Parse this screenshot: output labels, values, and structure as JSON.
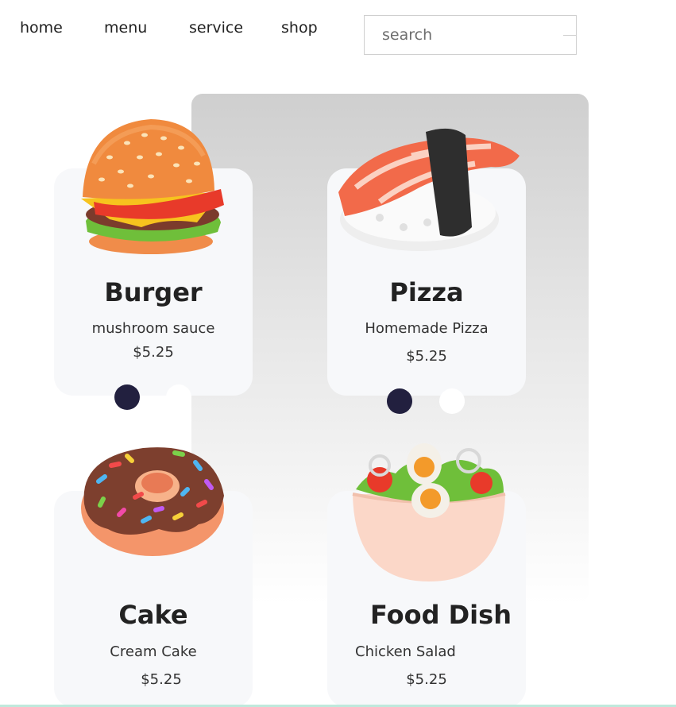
{
  "nav": {
    "items": [
      "home",
      "menu",
      "service",
      "shop"
    ]
  },
  "search": {
    "placeholder": "search"
  },
  "cards": [
    {
      "title": "Burger",
      "desc": "mushroom sauce",
      "price": "$5.25",
      "icon": "burger-icon"
    },
    {
      "title": "Pizza",
      "desc": "Homemade Pizza",
      "price": "$5.25",
      "icon": "sushi-icon"
    },
    {
      "title": "Cake",
      "desc": "Cream Cake",
      "price": "$5.25",
      "icon": "donut-icon"
    },
    {
      "title": "Food Dish",
      "desc": "Chicken Salad",
      "price": "$5.25",
      "icon": "salad-bowl-icon"
    }
  ],
  "colors": {
    "accent_dot": "#22203f",
    "card_bg": "#f7f8fa"
  }
}
